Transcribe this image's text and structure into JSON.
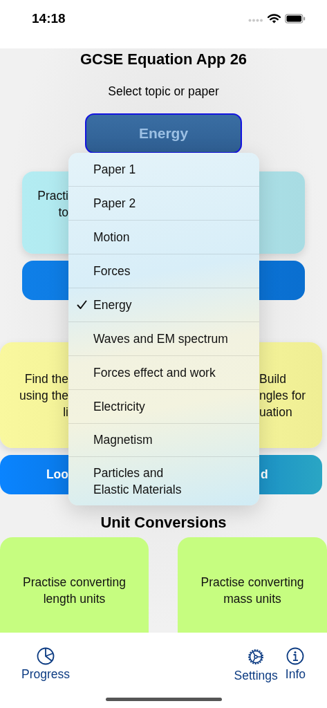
{
  "status_bar": {
    "time": "14:18"
  },
  "title": "GCSE Equation App 26",
  "subtitle": "Select topic or paper",
  "topic_button": {
    "label": "Energy"
  },
  "practice_card": {
    "lines": [
      "Practi",
      "to"
    ]
  },
  "equation_cards": [
    {
      "lines": [
        "Find the",
        "using the",
        "li"
      ]
    },
    {
      "lines": [
        "Build",
        "ngles for",
        "uation"
      ]
    }
  ],
  "equation_buttons": [
    {
      "label": "Loo"
    },
    {
      "label": "d"
    }
  ],
  "section_title": "Unit Conversions",
  "conversion_cards": [
    {
      "text": "Practise converting length units"
    },
    {
      "text": "Practise converting mass units"
    }
  ],
  "menu": {
    "items": [
      {
        "label": "Paper 1",
        "selected": false
      },
      {
        "label": "Paper 2",
        "selected": false
      },
      {
        "label": "Motion",
        "selected": false
      },
      {
        "label": "Forces",
        "selected": false
      },
      {
        "label": "Energy",
        "selected": true
      },
      {
        "label": "Waves and EM spectrum",
        "selected": false
      },
      {
        "label": "Forces effect and work",
        "selected": false
      },
      {
        "label": "Electricity",
        "selected": false
      },
      {
        "label": "Magnetism",
        "selected": false
      },
      {
        "label": "Particles and\nElastic Materials",
        "selected": false
      }
    ]
  },
  "tab_bar": {
    "items": [
      {
        "label": "Progress",
        "kind": "progress"
      },
      {
        "label": "Settings",
        "kind": "settings"
      },
      {
        "label": "Info",
        "kind": "info"
      }
    ]
  }
}
